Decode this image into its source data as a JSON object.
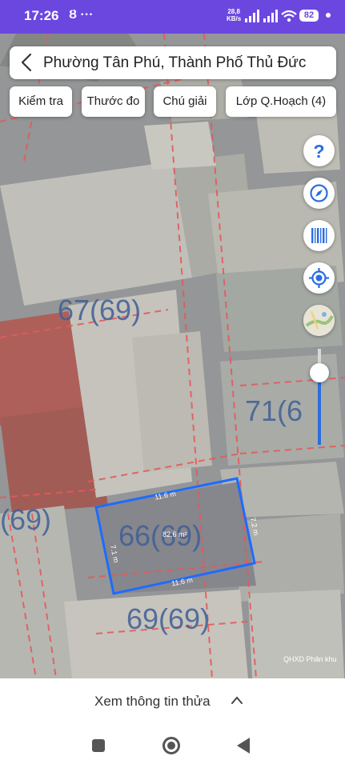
{
  "status_bar": {
    "time": "17:26",
    "notification_icons": "Ȣ ···",
    "net_speed_value": "28,8",
    "net_speed_unit": "KB/s",
    "battery": "82"
  },
  "header": {
    "title": "Phường Tân Phú, Thành Phố Thủ Đức"
  },
  "toolbar": {
    "check_label": "Kiểm tra",
    "measure_label": "Thước đo",
    "legend_label": "Chú giải",
    "layer_label": "Lớp Q.Hoạch (4)"
  },
  "side_controls": {
    "help_symbol": "?",
    "icons": [
      "help-icon",
      "compass-icon",
      "barcode-icon",
      "locate-icon",
      "basemap-thumbnail"
    ],
    "zoom_slider_value": 0.75
  },
  "map": {
    "parcel_labels": [
      "67(69)",
      "71(6",
      "(69)",
      "66(69)",
      "69(69)"
    ],
    "measurement": {
      "top_edge": "11.6 m",
      "bottom_edge": "11.6 m",
      "left_edge": "7.1 m",
      "right_edge": "7.2 m",
      "area": "82.6 m²"
    },
    "watermark": "QHXD Phân khu",
    "colors": {
      "measure_outline": "#1e6bff",
      "plan_boundary": "#e45a5a",
      "parcel_label": "#3f5f95"
    }
  },
  "bottom_panel": {
    "info_label": "Xem thông tin thửa"
  }
}
